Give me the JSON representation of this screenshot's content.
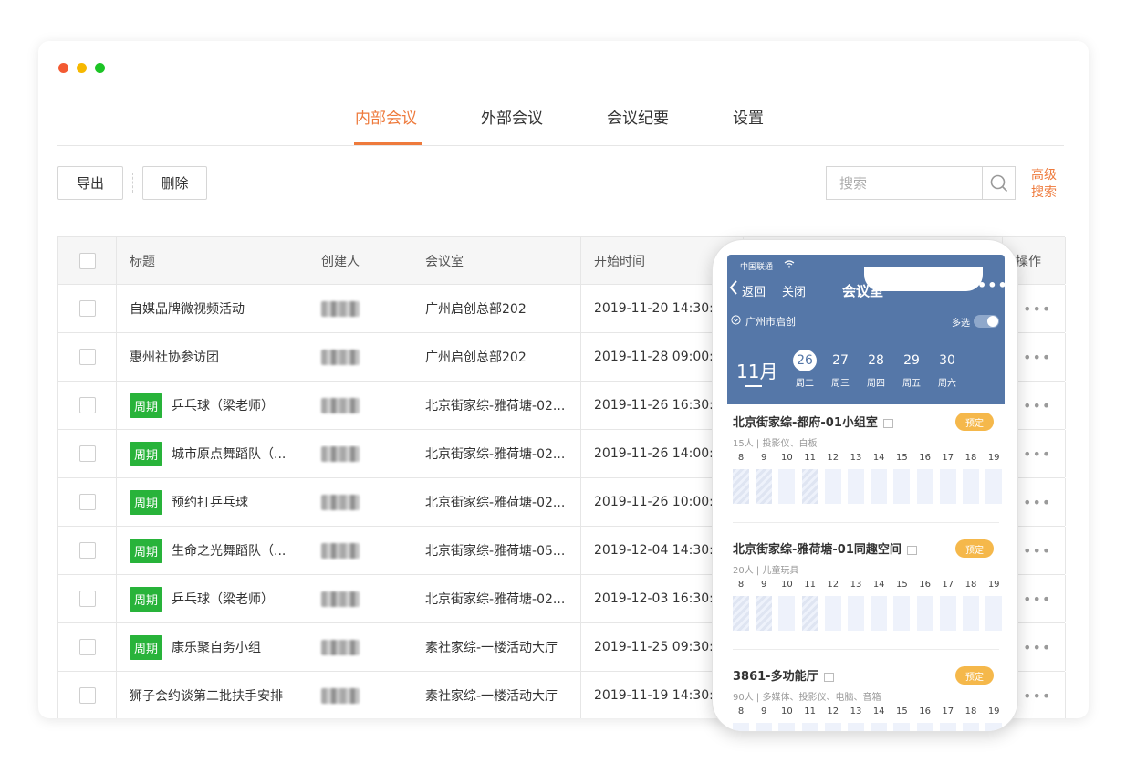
{
  "window": {
    "dots": [
      {
        "name": "close-dot",
        "color": "#f35a32"
      },
      {
        "name": "minimize-dot",
        "color": "#f6b800"
      },
      {
        "name": "maximize-dot",
        "color": "#1cc425"
      }
    ]
  },
  "tabs": [
    {
      "label": "内部会议",
      "active": true
    },
    {
      "label": "外部会议",
      "active": false
    },
    {
      "label": "会议纪要",
      "active": false
    },
    {
      "label": "设置",
      "active": false
    }
  ],
  "toolbar": {
    "export_label": "导出",
    "delete_label": "删除",
    "search_placeholder": "搜索",
    "advanced_search_label": "高级搜索",
    "search_icon": "search-icon"
  },
  "table": {
    "columns": [
      "标题",
      "创建人",
      "会议室",
      "开始时间",
      "操作"
    ],
    "recurring_tag": "周期",
    "more_icon": "more-icon",
    "rows": [
      {
        "title": "自媒品牌微视频活动",
        "recurring": false,
        "room": "广州启创总部202",
        "start": "2019-11-20 14:30:00"
      },
      {
        "title": "惠州社协参访团",
        "recurring": false,
        "room": "广州启创总部202",
        "start": "2019-11-28 09:00:00"
      },
      {
        "title": "乒乓球（梁老师）",
        "recurring": true,
        "room": "北京街家综-雅荷塘-02...",
        "start": "2019-11-26 16:30:00"
      },
      {
        "title": "城市原点舞蹈队（...",
        "recurring": true,
        "room": "北京街家综-雅荷塘-02...",
        "start": "2019-11-26 14:00:00"
      },
      {
        "title": "预约打乒乓球",
        "recurring": true,
        "room": "北京街家综-雅荷塘-02...",
        "start": "2019-11-26 10:00:00"
      },
      {
        "title": "生命之光舞蹈队（...",
        "recurring": true,
        "room": "北京街家综-雅荷塘-05...",
        "start": "2019-12-04 14:30:00"
      },
      {
        "title": "乒乓球（梁老师）",
        "recurring": true,
        "room": "北京街家综-雅荷塘-02...",
        "start": "2019-12-03 16:30:00"
      },
      {
        "title": "康乐聚自务小组",
        "recurring": true,
        "room": "素社家综-一楼活动大厅",
        "start": "2019-11-25 09:30:00"
      },
      {
        "title": "狮子会约谈第二批扶手安排",
        "recurring": false,
        "room": "素社家综-一楼活动大厅",
        "start": "2019-11-19 14:30:00"
      }
    ]
  },
  "phone": {
    "carrier": "中国联通",
    "back_label": "返回",
    "close_label": "关闭",
    "title": "会议室",
    "more_icon": "more-icon",
    "location": "广州市启创",
    "multi_label": "多选",
    "month": "11月",
    "days": [
      {
        "num": "26",
        "week": "周二",
        "selected": true
      },
      {
        "num": "27",
        "week": "周三",
        "selected": false
      },
      {
        "num": "28",
        "week": "周四",
        "selected": false
      },
      {
        "num": "29",
        "week": "周五",
        "selected": false
      },
      {
        "num": "30",
        "week": "周六",
        "selected": false
      }
    ],
    "book_label": "预定",
    "hours": [
      "8",
      "9",
      "10",
      "11",
      "12",
      "13",
      "14",
      "15",
      "16",
      "17",
      "18",
      "19"
    ],
    "rooms": [
      {
        "name": "北京街家综-都府-01小组室",
        "info": "15人 | 投影仪、白板",
        "busy": [
          0,
          1,
          3
        ]
      },
      {
        "name": "北京街家综-雅荷塘-01同趣空间",
        "info": "20人 | 儿童玩具",
        "busy": [
          0,
          1,
          3
        ]
      },
      {
        "name": "3861-多功能厅",
        "info": "90人 | 多媒体、投影仪、电脑、音箱",
        "busy": []
      }
    ]
  }
}
